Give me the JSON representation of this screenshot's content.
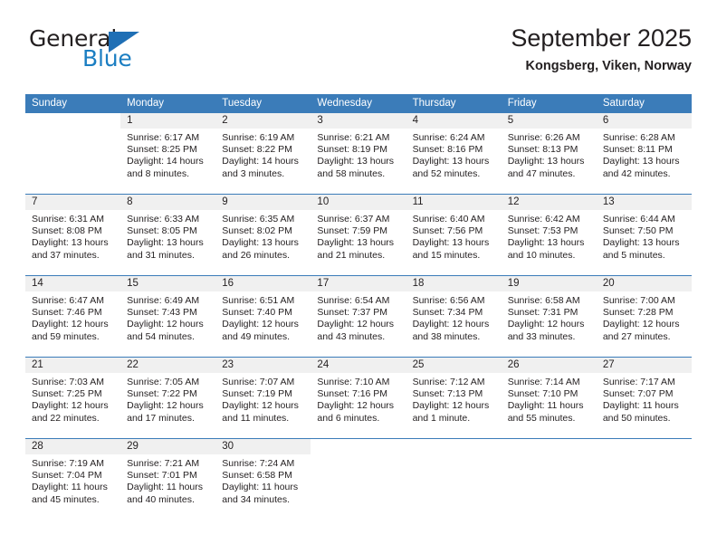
{
  "brand": {
    "name_top": "General",
    "name_bottom": "Blue",
    "triangle_color": "#1f6fb5",
    "blue_text_color": "#1b7ec2"
  },
  "header": {
    "title": "September 2025",
    "subtitle": "Kongsberg, Viken, Norway",
    "header_bg_color": "#3b7cb9",
    "daynum_band_color": "#f0f0f0"
  },
  "weekdays": [
    "Sunday",
    "Monday",
    "Tuesday",
    "Wednesday",
    "Thursday",
    "Friday",
    "Saturday"
  ],
  "weeks": [
    {
      "days": [
        {
          "num": "",
          "sunrise": "",
          "sunset": "",
          "daylight1": "",
          "daylight2": ""
        },
        {
          "num": "1",
          "sunrise": "Sunrise: 6:17 AM",
          "sunset": "Sunset: 8:25 PM",
          "daylight1": "Daylight: 14 hours",
          "daylight2": "and 8 minutes."
        },
        {
          "num": "2",
          "sunrise": "Sunrise: 6:19 AM",
          "sunset": "Sunset: 8:22 PM",
          "daylight1": "Daylight: 14 hours",
          "daylight2": "and 3 minutes."
        },
        {
          "num": "3",
          "sunrise": "Sunrise: 6:21 AM",
          "sunset": "Sunset: 8:19 PM",
          "daylight1": "Daylight: 13 hours",
          "daylight2": "and 58 minutes."
        },
        {
          "num": "4",
          "sunrise": "Sunrise: 6:24 AM",
          "sunset": "Sunset: 8:16 PM",
          "daylight1": "Daylight: 13 hours",
          "daylight2": "and 52 minutes."
        },
        {
          "num": "5",
          "sunrise": "Sunrise: 6:26 AM",
          "sunset": "Sunset: 8:13 PM",
          "daylight1": "Daylight: 13 hours",
          "daylight2": "and 47 minutes."
        },
        {
          "num": "6",
          "sunrise": "Sunrise: 6:28 AM",
          "sunset": "Sunset: 8:11 PM",
          "daylight1": "Daylight: 13 hours",
          "daylight2": "and 42 minutes."
        }
      ]
    },
    {
      "days": [
        {
          "num": "7",
          "sunrise": "Sunrise: 6:31 AM",
          "sunset": "Sunset: 8:08 PM",
          "daylight1": "Daylight: 13 hours",
          "daylight2": "and 37 minutes."
        },
        {
          "num": "8",
          "sunrise": "Sunrise: 6:33 AM",
          "sunset": "Sunset: 8:05 PM",
          "daylight1": "Daylight: 13 hours",
          "daylight2": "and 31 minutes."
        },
        {
          "num": "9",
          "sunrise": "Sunrise: 6:35 AM",
          "sunset": "Sunset: 8:02 PM",
          "daylight1": "Daylight: 13 hours",
          "daylight2": "and 26 minutes."
        },
        {
          "num": "10",
          "sunrise": "Sunrise: 6:37 AM",
          "sunset": "Sunset: 7:59 PM",
          "daylight1": "Daylight: 13 hours",
          "daylight2": "and 21 minutes."
        },
        {
          "num": "11",
          "sunrise": "Sunrise: 6:40 AM",
          "sunset": "Sunset: 7:56 PM",
          "daylight1": "Daylight: 13 hours",
          "daylight2": "and 15 minutes."
        },
        {
          "num": "12",
          "sunrise": "Sunrise: 6:42 AM",
          "sunset": "Sunset: 7:53 PM",
          "daylight1": "Daylight: 13 hours",
          "daylight2": "and 10 minutes."
        },
        {
          "num": "13",
          "sunrise": "Sunrise: 6:44 AM",
          "sunset": "Sunset: 7:50 PM",
          "daylight1": "Daylight: 13 hours",
          "daylight2": "and 5 minutes."
        }
      ]
    },
    {
      "days": [
        {
          "num": "14",
          "sunrise": "Sunrise: 6:47 AM",
          "sunset": "Sunset: 7:46 PM",
          "daylight1": "Daylight: 12 hours",
          "daylight2": "and 59 minutes."
        },
        {
          "num": "15",
          "sunrise": "Sunrise: 6:49 AM",
          "sunset": "Sunset: 7:43 PM",
          "daylight1": "Daylight: 12 hours",
          "daylight2": "and 54 minutes."
        },
        {
          "num": "16",
          "sunrise": "Sunrise: 6:51 AM",
          "sunset": "Sunset: 7:40 PM",
          "daylight1": "Daylight: 12 hours",
          "daylight2": "and 49 minutes."
        },
        {
          "num": "17",
          "sunrise": "Sunrise: 6:54 AM",
          "sunset": "Sunset: 7:37 PM",
          "daylight1": "Daylight: 12 hours",
          "daylight2": "and 43 minutes."
        },
        {
          "num": "18",
          "sunrise": "Sunrise: 6:56 AM",
          "sunset": "Sunset: 7:34 PM",
          "daylight1": "Daylight: 12 hours",
          "daylight2": "and 38 minutes."
        },
        {
          "num": "19",
          "sunrise": "Sunrise: 6:58 AM",
          "sunset": "Sunset: 7:31 PM",
          "daylight1": "Daylight: 12 hours",
          "daylight2": "and 33 minutes."
        },
        {
          "num": "20",
          "sunrise": "Sunrise: 7:00 AM",
          "sunset": "Sunset: 7:28 PM",
          "daylight1": "Daylight: 12 hours",
          "daylight2": "and 27 minutes."
        }
      ]
    },
    {
      "days": [
        {
          "num": "21",
          "sunrise": "Sunrise: 7:03 AM",
          "sunset": "Sunset: 7:25 PM",
          "daylight1": "Daylight: 12 hours",
          "daylight2": "and 22 minutes."
        },
        {
          "num": "22",
          "sunrise": "Sunrise: 7:05 AM",
          "sunset": "Sunset: 7:22 PM",
          "daylight1": "Daylight: 12 hours",
          "daylight2": "and 17 minutes."
        },
        {
          "num": "23",
          "sunrise": "Sunrise: 7:07 AM",
          "sunset": "Sunset: 7:19 PM",
          "daylight1": "Daylight: 12 hours",
          "daylight2": "and 11 minutes."
        },
        {
          "num": "24",
          "sunrise": "Sunrise: 7:10 AM",
          "sunset": "Sunset: 7:16 PM",
          "daylight1": "Daylight: 12 hours",
          "daylight2": "and 6 minutes."
        },
        {
          "num": "25",
          "sunrise": "Sunrise: 7:12 AM",
          "sunset": "Sunset: 7:13 PM",
          "daylight1": "Daylight: 12 hours",
          "daylight2": "and 1 minute."
        },
        {
          "num": "26",
          "sunrise": "Sunrise: 7:14 AM",
          "sunset": "Sunset: 7:10 PM",
          "daylight1": "Daylight: 11 hours",
          "daylight2": "and 55 minutes."
        },
        {
          "num": "27",
          "sunrise": "Sunrise: 7:17 AM",
          "sunset": "Sunset: 7:07 PM",
          "daylight1": "Daylight: 11 hours",
          "daylight2": "and 50 minutes."
        }
      ]
    },
    {
      "days": [
        {
          "num": "28",
          "sunrise": "Sunrise: 7:19 AM",
          "sunset": "Sunset: 7:04 PM",
          "daylight1": "Daylight: 11 hours",
          "daylight2": "and 45 minutes."
        },
        {
          "num": "29",
          "sunrise": "Sunrise: 7:21 AM",
          "sunset": "Sunset: 7:01 PM",
          "daylight1": "Daylight: 11 hours",
          "daylight2": "and 40 minutes."
        },
        {
          "num": "30",
          "sunrise": "Sunrise: 7:24 AM",
          "sunset": "Sunset: 6:58 PM",
          "daylight1": "Daylight: 11 hours",
          "daylight2": "and 34 minutes."
        },
        {
          "num": "",
          "sunrise": "",
          "sunset": "",
          "daylight1": "",
          "daylight2": ""
        },
        {
          "num": "",
          "sunrise": "",
          "sunset": "",
          "daylight1": "",
          "daylight2": ""
        },
        {
          "num": "",
          "sunrise": "",
          "sunset": "",
          "daylight1": "",
          "daylight2": ""
        },
        {
          "num": "",
          "sunrise": "",
          "sunset": "",
          "daylight1": "",
          "daylight2": ""
        }
      ]
    }
  ]
}
